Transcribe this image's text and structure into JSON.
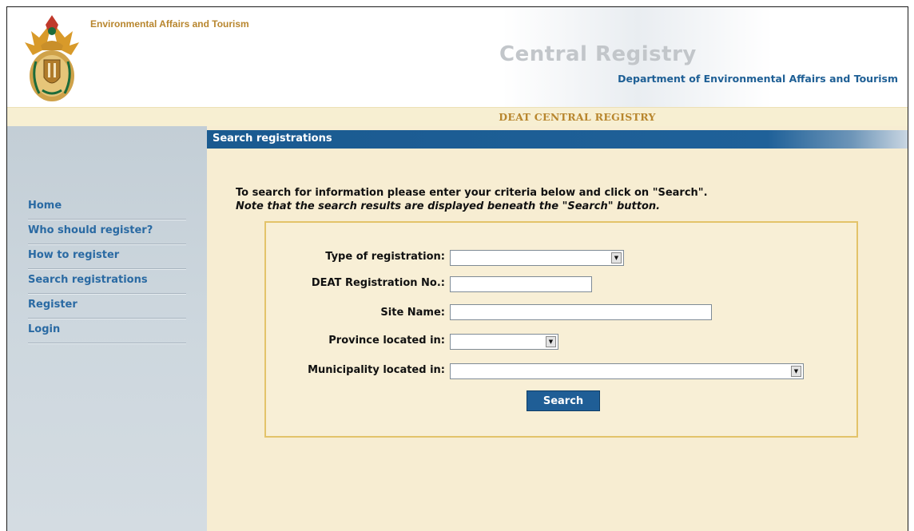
{
  "header": {
    "org_name": "Environmental Affairs and Tourism",
    "site_title": "Central Registry",
    "dept_name": "Department of Environmental Affairs and Tourism"
  },
  "banner": {
    "text": "DEAT CENTRAL REGISTRY"
  },
  "sidebar": {
    "items": [
      {
        "label": "Home"
      },
      {
        "label": "Who should register?"
      },
      {
        "label": "How to register"
      },
      {
        "label": "Search registrations"
      },
      {
        "label": "Register"
      },
      {
        "label": "Login"
      }
    ]
  },
  "main": {
    "section_title": "Search registrations",
    "instruction": "To search for information please enter your criteria below and click on \"Search\".",
    "note": "Note that the search results are displayed beneath the \"Search\" button."
  },
  "form": {
    "type_label": "Type of registration:",
    "type_value": "",
    "reg_no_label": "DEAT Registration No.:",
    "reg_no_value": "",
    "site_name_label": "Site Name:",
    "site_name_value": "",
    "province_label": "Province located in:",
    "province_value": "",
    "municipality_label": "Municipality located in:",
    "municipality_value": "",
    "search_label": "Search"
  },
  "colors": {
    "accent_blue": "#1f5e96",
    "nav_link": "#2a6aa3",
    "gold": "#b8862e",
    "panel_bg": "#f7edd2",
    "sidebar_bg": "#cdd7de"
  },
  "icons": {
    "crest": "coat-of-arms",
    "dropdown": "dropdown-arrow-icon"
  }
}
